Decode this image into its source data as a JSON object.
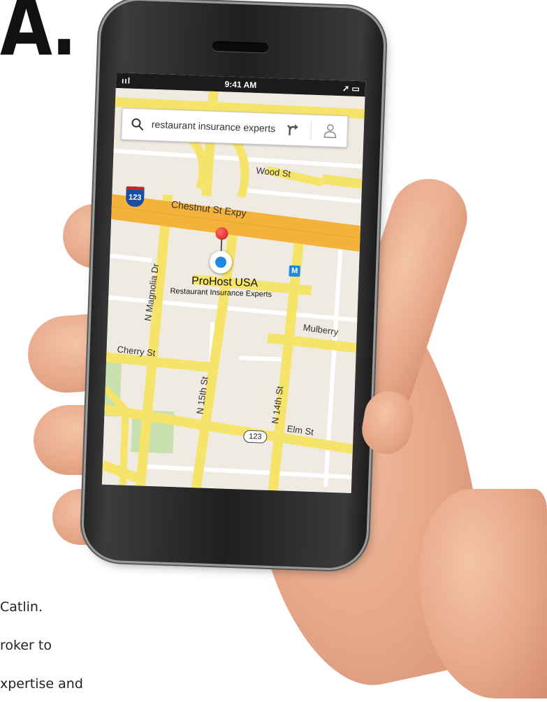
{
  "headline": "A.",
  "body_text": {
    "line1": "Catlin.",
    "line2": "roker to",
    "line3": "xpertise and"
  },
  "status_bar": {
    "signal": "ııl",
    "time": "9:41 AM",
    "right_icons": "➚ ▭"
  },
  "search": {
    "query": "restaurant insurance experts"
  },
  "map": {
    "streets": {
      "wood": "Wood St",
      "chestnut": "Chestnut St Expy",
      "magnolia": "N Magnolia Dr",
      "mulberry": "Mulberry",
      "cherry": "Cherry St",
      "n15": "N 15th St",
      "n14": "N 14th St",
      "elm": "Elm St"
    },
    "interstate_shield": "123",
    "route_shield": "123",
    "metro_label": "M",
    "place_name": "ProHost USA",
    "place_subtitle": "Restaurant Insurance Experts"
  },
  "colors": {
    "road_yellow": "#f6e46a",
    "expressway_orange": "#f4b23a",
    "map_background": "#efeae2",
    "park_green": "#c8dfb0",
    "pin_red": "#e53935",
    "location_blue": "#1e88e5"
  }
}
